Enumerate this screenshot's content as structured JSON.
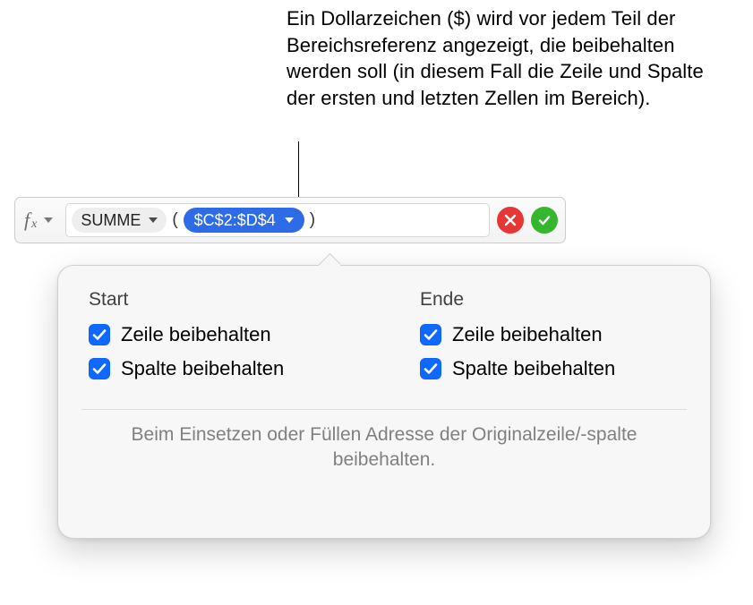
{
  "annotation": "Ein Dollarzeichen ($) wird vor jedem Teil der Bereichsreferenz angezeigt, die beibehalten werden soll (in diesem Fall die Zeile und Spalte der ersten und letzten Zellen im Bereich).",
  "formula": {
    "fn_token": "SUMME",
    "range_token": "$C$2:$D$4"
  },
  "popover": {
    "start": {
      "title": "Start",
      "row_label": "Zeile beibehalten",
      "col_label": "Spalte beibehalten"
    },
    "end": {
      "title": "Ende",
      "row_label": "Zeile beibehalten",
      "col_label": "Spalte beibehalten"
    },
    "note": "Beim Einsetzen oder Füllen Adresse der Originalzeile/-spalte beibehalten."
  }
}
